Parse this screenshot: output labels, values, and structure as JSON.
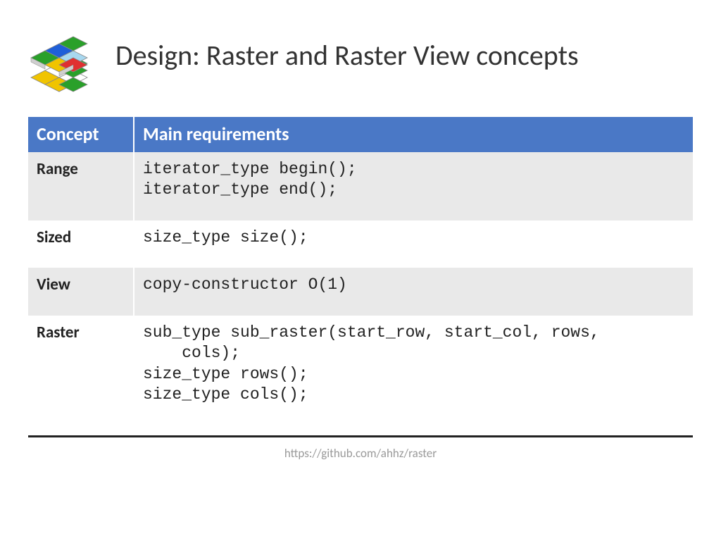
{
  "title": "Design: Raster and Raster View concepts",
  "table": {
    "header": {
      "col1": "Concept",
      "col2": "Main requirements"
    },
    "rows": [
      {
        "concept": "Range",
        "req": "iterator_type begin();\niterator_type end();"
      },
      {
        "concept": "Sized",
        "req": "size_type size();"
      },
      {
        "concept": "View",
        "req": "copy-constructor O(1)"
      },
      {
        "concept": "Raster",
        "req": "sub_type sub_raster(start_row, start_col, rows,\n    cols);\nsize_type rows();\nsize_type cols();"
      }
    ]
  },
  "footer_url": "https://github.com/ahhz/raster"
}
